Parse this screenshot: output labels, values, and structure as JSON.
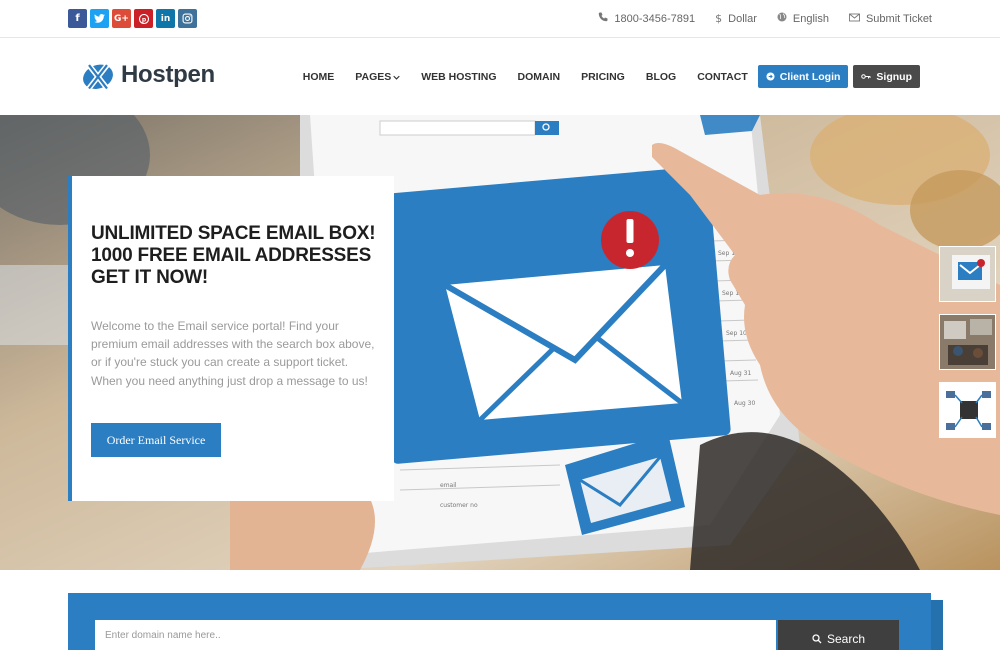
{
  "social": [
    {
      "icon": "facebook-icon",
      "glyph": "f",
      "color": "#3b5998"
    },
    {
      "icon": "twitter-icon",
      "glyph": "t",
      "color": "#1da1f2"
    },
    {
      "icon": "google-plus-icon",
      "glyph": "G+",
      "color": "#dd4b39"
    },
    {
      "icon": "pinterest-icon",
      "glyph": "p",
      "color": "#cb2027"
    },
    {
      "icon": "linkedin-icon",
      "glyph": "in",
      "color": "#0e76a8"
    },
    {
      "icon": "instagram-icon",
      "glyph": "◎",
      "color": "#3f729b"
    }
  ],
  "topbar": {
    "phone": "1800-3456-7891",
    "currency": "Dollar",
    "language": "English",
    "ticket": "Submit Ticket"
  },
  "brand": {
    "name": "Hostpen",
    "accent": "#2b7ec1"
  },
  "nav": {
    "home": "HOME",
    "pages": "PAGES",
    "web_hosting": "WEB HOSTING",
    "domain": "DOMAIN",
    "pricing": "PRICING",
    "blog": "BLOG",
    "contact": "CONTACT",
    "client_login": "Client Login",
    "signup": "Signup"
  },
  "hero": {
    "title_line1": "UNLIMITED SPACE EMAIL BOX!",
    "title_line2": "1000 FREE EMAIL ADDRESSES",
    "title_line3": "GET IT NOW!",
    "text": "Welcome to the Email service portal! Find your premium email addresses with the search box above, or if you're stuck you can create a support ticket. When you need anything just drop a message to us!",
    "cta": "Order Email Service"
  },
  "search": {
    "placeholder": "Enter domain name here..",
    "button": "Search"
  }
}
